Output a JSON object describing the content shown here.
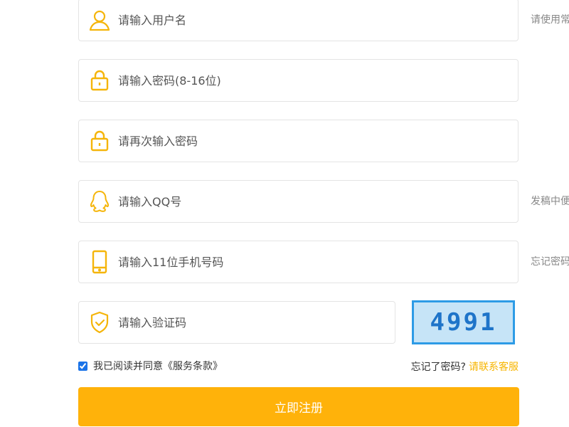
{
  "form": {
    "username": {
      "placeholder": "请输入用户名",
      "icon": "user-icon"
    },
    "password": {
      "placeholder": "请输入密码(8-16位)",
      "icon": "lock-icon"
    },
    "confirm_password": {
      "placeholder": "请再次输入密码",
      "icon": "lock-icon"
    },
    "qq": {
      "placeholder": "请输入QQ号",
      "icon": "qq-penguin-icon"
    },
    "phone": {
      "placeholder": "请输入11位手机号码",
      "icon": "phone-icon"
    },
    "captcha_input": {
      "placeholder": "请输入验证码",
      "icon": "shield-check-icon"
    },
    "captcha_code": "4991"
  },
  "hints": {
    "username": "请使用常",
    "qq": "发稿中便",
    "phone": "忘记密码"
  },
  "agreement": {
    "checked": true,
    "label": "我已阅读并同意《服务条款》"
  },
  "forgot": {
    "text": "忘记了密码?",
    "link": "请联系客服"
  },
  "submit_label": "立即注册",
  "colors": {
    "accent": "#ffb20a",
    "link": "#f7b500",
    "captcha_border": "#2d9be6",
    "captcha_bg": "#c6e4f7",
    "captcha_text": "#1e74c9"
  }
}
